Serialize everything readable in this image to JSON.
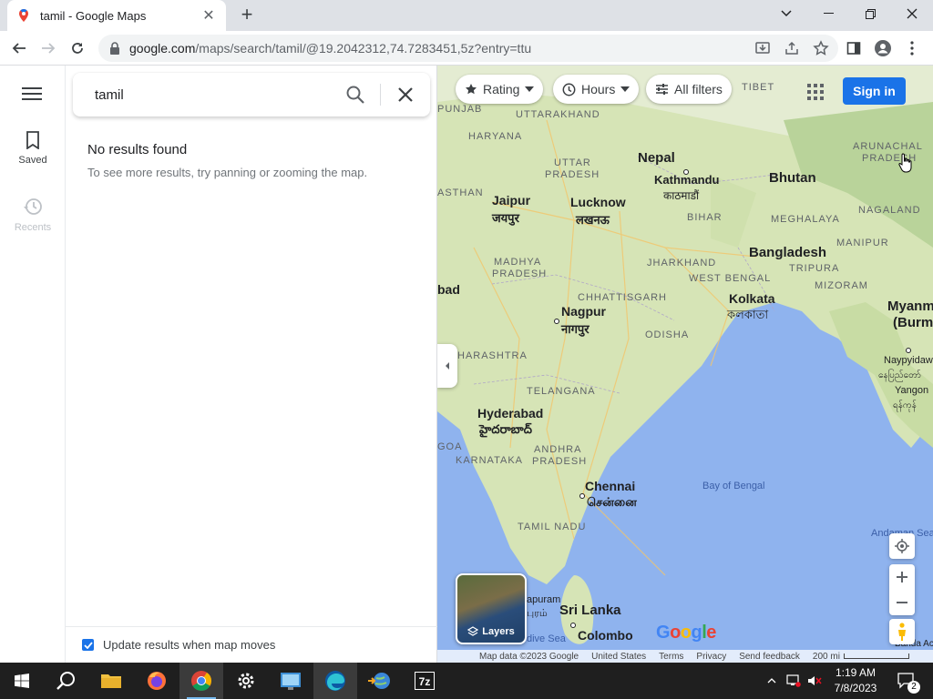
{
  "browser": {
    "tab_title": "tamil - Google Maps",
    "url_host": "google.com",
    "url_rest": "/maps/search/tamil/@19.2042312,74.7283451,5z?entry=ttu"
  },
  "rail": {
    "saved_label": "Saved",
    "recents_label": "Recents"
  },
  "search": {
    "query": "tamil",
    "no_results_title": "No results found",
    "no_results_hint": "To see more results, try panning or zooming the map.",
    "update_results_label": "Update results when map moves",
    "update_results_checked": true
  },
  "map": {
    "filters": {
      "rating": "Rating",
      "hours": "Hours",
      "all_filters": "All filters"
    },
    "sign_in": "Sign in",
    "layers_label": "Layers",
    "logo": "Google",
    "attribution": {
      "map_data": "Map data ©2023 Google",
      "region": "United States",
      "terms": "Terms",
      "privacy": "Privacy",
      "feedback": "Send feedback",
      "scale": "200 mi"
    },
    "labels": {
      "punjab": "PUNJAB",
      "uttarakhand": "UTTARAKHAND",
      "tibet": "TIBET",
      "haryana": "HARYANA",
      "nepal": "Nepal",
      "kathmandu": "Kathmandu",
      "kathmandu_native": "काठमाडौं",
      "uttar_pradesh_1": "UTTAR",
      "uttar_pradesh_2": "PRADESH",
      "arunachal_1": "ARUNACHAL",
      "arunachal_2": "PRADESH",
      "bhutan": "Bhutan",
      "rajasthan": "ASTHAN",
      "jaipur": "Jaipur",
      "jaipur_native": "जयपुर",
      "lucknow": "Lucknow",
      "lucknow_native": "लखनऊ",
      "bihar": "BIHAR",
      "meghalaya": "MEGHALAYA",
      "nagaland": "NAGALAND",
      "madhya_1": "MADHYA",
      "madhya_2": "PRADESH",
      "jharkhand": "JHARKHAND",
      "bangladesh": "Bangladesh",
      "manipur": "MANIPUR",
      "tripura": "TRIPURA",
      "west_bengal": "WEST BENGAL",
      "mizoram": "MIZORAM",
      "abad": "bad",
      "chhattisgarh": "CHHATTISGARH",
      "kolkata": "Kolkata",
      "kolkata_native": "কলকাতা",
      "myanmar_1": "Myanm",
      "myanmar_2": "(Burm",
      "nagpur": "Nagpur",
      "nagpur_native": "नागपुर",
      "odisha": "ODISHA",
      "maharashtra": "HARASHTRA",
      "naypyidaw": "Naypyidaw",
      "naypyidaw_native": "နေပြည်တော်",
      "telangana": "TELANGANA",
      "yangon": "Yangon",
      "yangon_native": "ရန်ကုန်",
      "hyderabad": "Hyderabad",
      "hyderabad_native": "హైదరాబాద్",
      "goa": "GOA",
      "andhra_1": "ANDHRA",
      "andhra_2": "PRADESH",
      "karnataka": "KARNATAKA",
      "chennai": "Chennai",
      "chennai_native": "சென்னை",
      "bay_of_bengal": "Bay of Bengal",
      "tamil_nadu": "TAMIL NADU",
      "andaman_sea": "Andaman Sea",
      "jaffna": "apuram",
      "jaffna_native": "புரம்",
      "sri_lanka": "Sri Lanka",
      "colombo": "Colombo",
      "maldive_sea": "dive Sea",
      "banda_aceh": "Banda Aceh"
    }
  },
  "taskbar": {
    "time": "1:19 AM",
    "date": "7/8/2023",
    "notification_count": "2"
  },
  "colors": {
    "accent": "#1a73e8",
    "water": "#8fb3ee",
    "land": "#d8e6b9",
    "taskbar": "#1f1f1f"
  }
}
